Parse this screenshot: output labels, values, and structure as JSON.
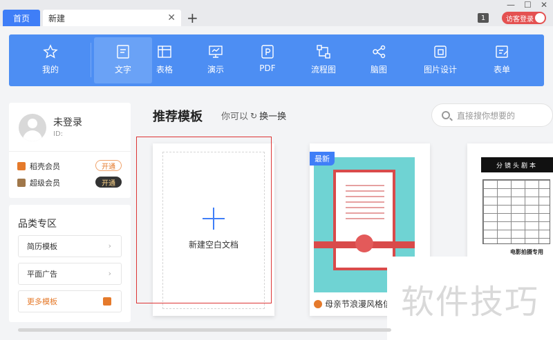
{
  "titlebar": {
    "home_tab": "首页",
    "new_tab": "新建",
    "close_glyph": "✕",
    "add_glyph": "+",
    "badge_count": "1",
    "login_label": "访客登录",
    "min_glyph": "—",
    "max_glyph": "☐",
    "close_win_glyph": "✕"
  },
  "toolbar": {
    "items": [
      {
        "label": "我的",
        "icon": "star-icon"
      },
      {
        "label": "文字",
        "icon": "document-icon",
        "active": true
      },
      {
        "label": "表格",
        "icon": "table-icon"
      },
      {
        "label": "演示",
        "icon": "presentation-icon"
      },
      {
        "label": "PDF",
        "icon": "pdf-icon"
      },
      {
        "label": "流程图",
        "icon": "flowchart-icon"
      },
      {
        "label": "脑图",
        "icon": "mindmap-icon"
      },
      {
        "label": "图片设计",
        "icon": "image-design-icon"
      },
      {
        "label": "表单",
        "icon": "form-icon"
      }
    ],
    "color": "#4d8ef3"
  },
  "user": {
    "name": "未登录",
    "id_label": "ID:",
    "members": [
      {
        "label": "稻壳会员",
        "button": "开通",
        "color": "#e57a2b"
      },
      {
        "label": "超级会员",
        "button": "开通",
        "color": "#a0774a"
      }
    ]
  },
  "categories": {
    "title": "品类专区",
    "items": [
      "简历模板",
      "平面广告",
      "更多模板"
    ],
    "chevron": "›"
  },
  "main": {
    "title": "推荐模板",
    "can_text": "你可以",
    "swap_icon": "↻",
    "swap_label": "换一换",
    "search_placeholder": "直接搜你想要的",
    "blank_label": "新建空白文档",
    "template1_badge": "最新",
    "template1_name": "母亲节浪漫风格信",
    "template2_head": "分镜头剧本",
    "template2_foot": "电影拍摄专用"
  },
  "watermark": "软件技巧",
  "accent": "#3f7ef7"
}
